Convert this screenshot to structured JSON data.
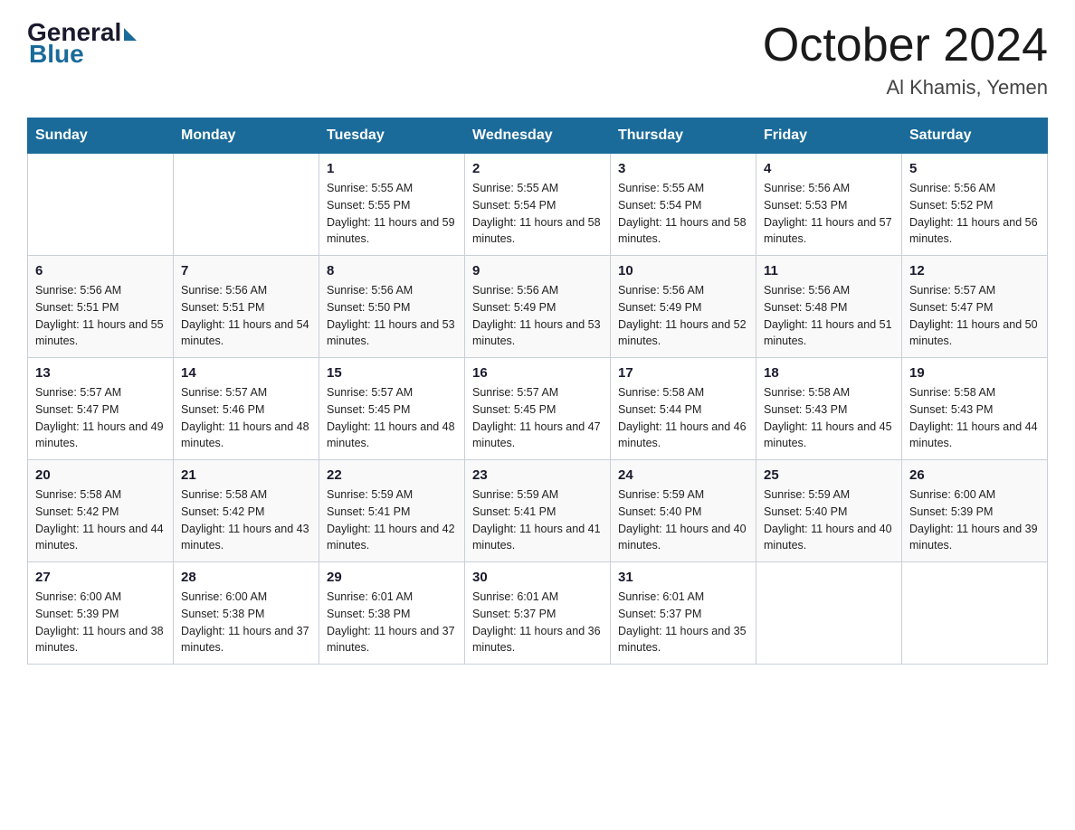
{
  "header": {
    "logo": {
      "general": "General",
      "blue": "Blue"
    },
    "title": "October 2024",
    "location": "Al Khamis, Yemen"
  },
  "days_of_week": [
    "Sunday",
    "Monday",
    "Tuesday",
    "Wednesday",
    "Thursday",
    "Friday",
    "Saturday"
  ],
  "weeks": [
    [
      {
        "day": "",
        "sunrise": "",
        "sunset": "",
        "daylight": ""
      },
      {
        "day": "",
        "sunrise": "",
        "sunset": "",
        "daylight": ""
      },
      {
        "day": "1",
        "sunrise": "Sunrise: 5:55 AM",
        "sunset": "Sunset: 5:55 PM",
        "daylight": "Daylight: 11 hours and 59 minutes."
      },
      {
        "day": "2",
        "sunrise": "Sunrise: 5:55 AM",
        "sunset": "Sunset: 5:54 PM",
        "daylight": "Daylight: 11 hours and 58 minutes."
      },
      {
        "day": "3",
        "sunrise": "Sunrise: 5:55 AM",
        "sunset": "Sunset: 5:54 PM",
        "daylight": "Daylight: 11 hours and 58 minutes."
      },
      {
        "day": "4",
        "sunrise": "Sunrise: 5:56 AM",
        "sunset": "Sunset: 5:53 PM",
        "daylight": "Daylight: 11 hours and 57 minutes."
      },
      {
        "day": "5",
        "sunrise": "Sunrise: 5:56 AM",
        "sunset": "Sunset: 5:52 PM",
        "daylight": "Daylight: 11 hours and 56 minutes."
      }
    ],
    [
      {
        "day": "6",
        "sunrise": "Sunrise: 5:56 AM",
        "sunset": "Sunset: 5:51 PM",
        "daylight": "Daylight: 11 hours and 55 minutes."
      },
      {
        "day": "7",
        "sunrise": "Sunrise: 5:56 AM",
        "sunset": "Sunset: 5:51 PM",
        "daylight": "Daylight: 11 hours and 54 minutes."
      },
      {
        "day": "8",
        "sunrise": "Sunrise: 5:56 AM",
        "sunset": "Sunset: 5:50 PM",
        "daylight": "Daylight: 11 hours and 53 minutes."
      },
      {
        "day": "9",
        "sunrise": "Sunrise: 5:56 AM",
        "sunset": "Sunset: 5:49 PM",
        "daylight": "Daylight: 11 hours and 53 minutes."
      },
      {
        "day": "10",
        "sunrise": "Sunrise: 5:56 AM",
        "sunset": "Sunset: 5:49 PM",
        "daylight": "Daylight: 11 hours and 52 minutes."
      },
      {
        "day": "11",
        "sunrise": "Sunrise: 5:56 AM",
        "sunset": "Sunset: 5:48 PM",
        "daylight": "Daylight: 11 hours and 51 minutes."
      },
      {
        "day": "12",
        "sunrise": "Sunrise: 5:57 AM",
        "sunset": "Sunset: 5:47 PM",
        "daylight": "Daylight: 11 hours and 50 minutes."
      }
    ],
    [
      {
        "day": "13",
        "sunrise": "Sunrise: 5:57 AM",
        "sunset": "Sunset: 5:47 PM",
        "daylight": "Daylight: 11 hours and 49 minutes."
      },
      {
        "day": "14",
        "sunrise": "Sunrise: 5:57 AM",
        "sunset": "Sunset: 5:46 PM",
        "daylight": "Daylight: 11 hours and 48 minutes."
      },
      {
        "day": "15",
        "sunrise": "Sunrise: 5:57 AM",
        "sunset": "Sunset: 5:45 PM",
        "daylight": "Daylight: 11 hours and 48 minutes."
      },
      {
        "day": "16",
        "sunrise": "Sunrise: 5:57 AM",
        "sunset": "Sunset: 5:45 PM",
        "daylight": "Daylight: 11 hours and 47 minutes."
      },
      {
        "day": "17",
        "sunrise": "Sunrise: 5:58 AM",
        "sunset": "Sunset: 5:44 PM",
        "daylight": "Daylight: 11 hours and 46 minutes."
      },
      {
        "day": "18",
        "sunrise": "Sunrise: 5:58 AM",
        "sunset": "Sunset: 5:43 PM",
        "daylight": "Daylight: 11 hours and 45 minutes."
      },
      {
        "day": "19",
        "sunrise": "Sunrise: 5:58 AM",
        "sunset": "Sunset: 5:43 PM",
        "daylight": "Daylight: 11 hours and 44 minutes."
      }
    ],
    [
      {
        "day": "20",
        "sunrise": "Sunrise: 5:58 AM",
        "sunset": "Sunset: 5:42 PM",
        "daylight": "Daylight: 11 hours and 44 minutes."
      },
      {
        "day": "21",
        "sunrise": "Sunrise: 5:58 AM",
        "sunset": "Sunset: 5:42 PM",
        "daylight": "Daylight: 11 hours and 43 minutes."
      },
      {
        "day": "22",
        "sunrise": "Sunrise: 5:59 AM",
        "sunset": "Sunset: 5:41 PM",
        "daylight": "Daylight: 11 hours and 42 minutes."
      },
      {
        "day": "23",
        "sunrise": "Sunrise: 5:59 AM",
        "sunset": "Sunset: 5:41 PM",
        "daylight": "Daylight: 11 hours and 41 minutes."
      },
      {
        "day": "24",
        "sunrise": "Sunrise: 5:59 AM",
        "sunset": "Sunset: 5:40 PM",
        "daylight": "Daylight: 11 hours and 40 minutes."
      },
      {
        "day": "25",
        "sunrise": "Sunrise: 5:59 AM",
        "sunset": "Sunset: 5:40 PM",
        "daylight": "Daylight: 11 hours and 40 minutes."
      },
      {
        "day": "26",
        "sunrise": "Sunrise: 6:00 AM",
        "sunset": "Sunset: 5:39 PM",
        "daylight": "Daylight: 11 hours and 39 minutes."
      }
    ],
    [
      {
        "day": "27",
        "sunrise": "Sunrise: 6:00 AM",
        "sunset": "Sunset: 5:39 PM",
        "daylight": "Daylight: 11 hours and 38 minutes."
      },
      {
        "day": "28",
        "sunrise": "Sunrise: 6:00 AM",
        "sunset": "Sunset: 5:38 PM",
        "daylight": "Daylight: 11 hours and 37 minutes."
      },
      {
        "day": "29",
        "sunrise": "Sunrise: 6:01 AM",
        "sunset": "Sunset: 5:38 PM",
        "daylight": "Daylight: 11 hours and 37 minutes."
      },
      {
        "day": "30",
        "sunrise": "Sunrise: 6:01 AM",
        "sunset": "Sunset: 5:37 PM",
        "daylight": "Daylight: 11 hours and 36 minutes."
      },
      {
        "day": "31",
        "sunrise": "Sunrise: 6:01 AM",
        "sunset": "Sunset: 5:37 PM",
        "daylight": "Daylight: 11 hours and 35 minutes."
      },
      {
        "day": "",
        "sunrise": "",
        "sunset": "",
        "daylight": ""
      },
      {
        "day": "",
        "sunrise": "",
        "sunset": "",
        "daylight": ""
      }
    ]
  ]
}
